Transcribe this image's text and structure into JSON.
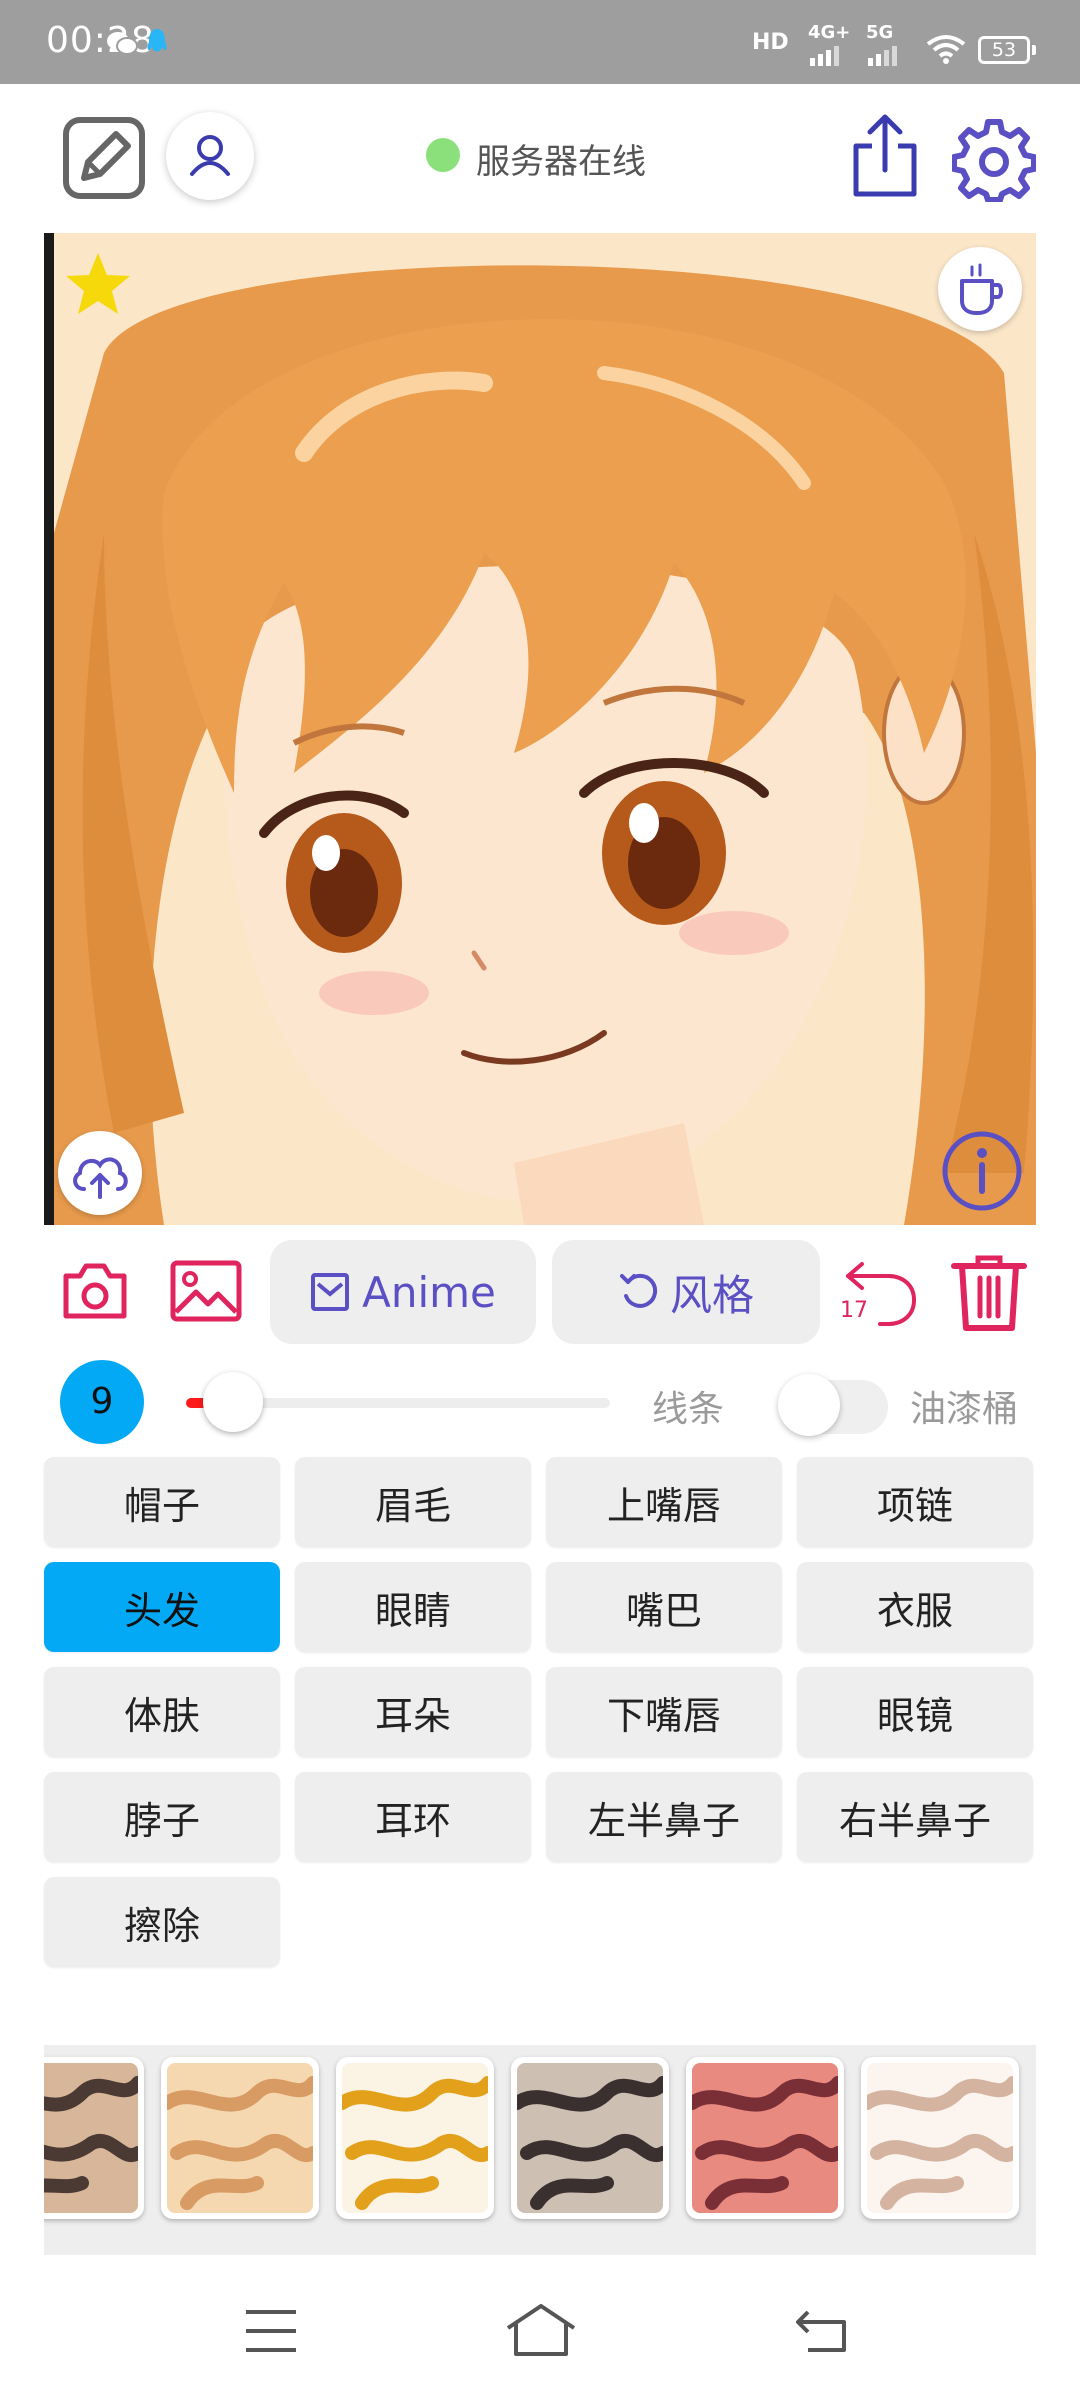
{
  "status_bar": {
    "time": "00:28",
    "network_1": "4G+",
    "network_2": "5G",
    "hd_label": "HD",
    "battery": "53"
  },
  "header": {
    "server_status": "服务器在线"
  },
  "toolbar": {
    "anime_label": "Anime",
    "style_label": "风格",
    "undo_count": "17"
  },
  "brush": {
    "size": "9",
    "size_fraction": 0.06,
    "mode_label": "线条",
    "fill_label": "油漆桶",
    "fill_enabled": false
  },
  "labels": [
    {
      "text": "帽子",
      "active": false
    },
    {
      "text": "眉毛",
      "active": false
    },
    {
      "text": "上嘴唇",
      "active": false
    },
    {
      "text": "项链",
      "active": false
    },
    {
      "text": "头发",
      "active": true
    },
    {
      "text": "眼睛",
      "active": false
    },
    {
      "text": "嘴巴",
      "active": false
    },
    {
      "text": "衣服",
      "active": false
    },
    {
      "text": "体肤",
      "active": false
    },
    {
      "text": "耳朵",
      "active": false
    },
    {
      "text": "下嘴唇",
      "active": false
    },
    {
      "text": "眼镜",
      "active": false
    },
    {
      "text": "脖子",
      "active": false
    },
    {
      "text": "耳环",
      "active": false
    },
    {
      "text": "左半鼻子",
      "active": false
    },
    {
      "text": "右半鼻子",
      "active": false
    },
    {
      "text": "擦除",
      "active": false
    }
  ],
  "style_thumbnails": [
    {
      "name": "style-1",
      "base": "#d8b69a",
      "accent": "#4a3a33"
    },
    {
      "name": "style-2",
      "base": "#f5d7b0",
      "accent": "#d79b63"
    },
    {
      "name": "style-3",
      "base": "#fbf3e4",
      "accent": "#e3a11b"
    },
    {
      "name": "style-4",
      "base": "#cdbfb2",
      "accent": "#3a3030"
    },
    {
      "name": "style-5",
      "base": "#e98a80",
      "accent": "#7a2f36"
    },
    {
      "name": "style-6",
      "base": "#fbf4ef",
      "accent": "#d4b4a0"
    }
  ],
  "colors": {
    "accent_purple": "#5b4fc4",
    "danger_pink": "#e0245e",
    "active_blue": "#03a9f4",
    "online_green": "#8be07c"
  }
}
